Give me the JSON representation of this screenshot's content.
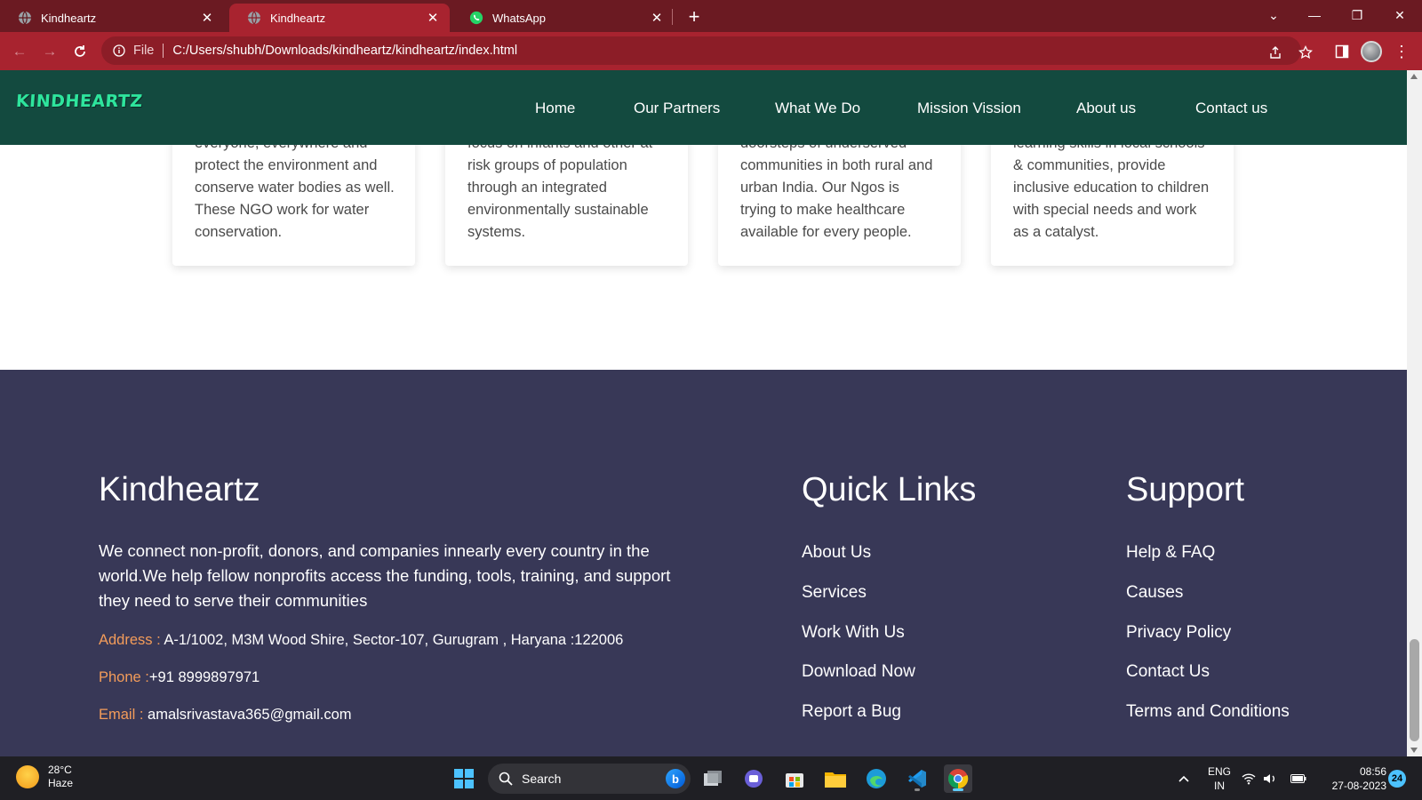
{
  "browser": {
    "tabs": [
      {
        "title": "Kindheartz",
        "icon": "globe-icon",
        "active": false
      },
      {
        "title": "Kindheartz",
        "icon": "globe-icon",
        "active": true
      },
      {
        "title": "WhatsApp",
        "icon": "whatsapp-icon",
        "active": false
      }
    ],
    "address": {
      "scheme_label": "File",
      "url": "C:/Users/shubh/Downloads/kindheartz/kindheartz/index.html"
    },
    "colors": {
      "tabbar": "#6b1a22",
      "toolbar": "#a8232f"
    }
  },
  "site": {
    "logo": "KINDHEARTZ",
    "nav": [
      "Home",
      "Our Partners",
      "What We Do",
      "Mission Vission",
      "About us",
      "Contact us"
    ],
    "colors": {
      "nav_bg": "#134a3f",
      "logo": "#2ee59d",
      "footer_bg": "#383857",
      "contact_label": "#f39c5a"
    }
  },
  "cards": [
    {
      "lines": [
        "everyone, everywhere and",
        "protect the environment and",
        "conserve water bodies as well.",
        "These NGO work for water",
        "conservation."
      ]
    },
    {
      "lines": [
        "focus on infants and other at",
        "risk groups of population",
        "through an integrated",
        "environmentally sustainable",
        "systems."
      ]
    },
    {
      "lines": [
        "doorsteps of underserved",
        "communities in both rural and",
        "urban India. Our Ngos is",
        "trying to make healthcare",
        "available for every people."
      ]
    },
    {
      "lines": [
        "learning skills in local schools",
        "& communities, provide",
        "inclusive education to children",
        "with special needs and work",
        "as a catalyst."
      ]
    }
  ],
  "footer": {
    "brand": {
      "title": "Kindheartz",
      "description": "We connect non-profit, donors, and companies innearly every country in the world.We help fellow nonprofits access the funding, tools, training, and support they need to serve their communities",
      "address_label": "Address :",
      "address": " A-1/1002, M3M Wood Shire, Sector-107, Gurugram , Haryana :122006",
      "phone_label": "Phone :",
      "phone": "+91 8999897971",
      "email_label": "Email :",
      "email": " amalsrivastava365@gmail.com"
    },
    "quick_links": {
      "title": "Quick Links",
      "items": [
        "About Us",
        "Services",
        "Work With Us",
        "Download Now",
        "Report a Bug"
      ]
    },
    "support": {
      "title": "Support",
      "items": [
        "Help & FAQ",
        "Causes",
        "Privacy Policy",
        "Contact Us",
        "Terms and Conditions"
      ]
    }
  },
  "taskbar": {
    "weather": {
      "temp": "28°C",
      "condition": "Haze"
    },
    "search_placeholder": "Search",
    "language": {
      "line1": "ENG",
      "line2": "IN"
    },
    "clock": {
      "time": "08:56",
      "date": "27-08-2023"
    },
    "notifications": "24"
  }
}
